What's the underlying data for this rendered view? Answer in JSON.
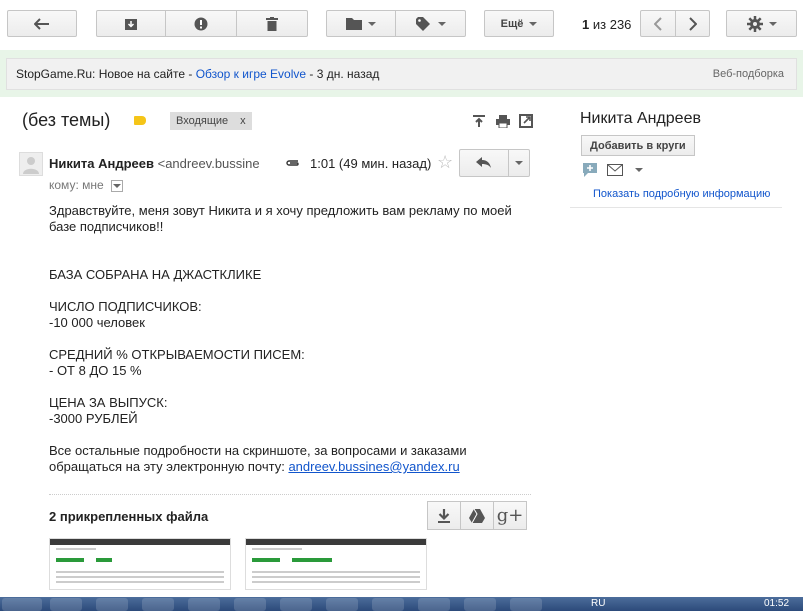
{
  "toolbar": {
    "more_label": "Ещё",
    "pager_current": "1",
    "pager_sep": "из",
    "pager_total": "236"
  },
  "promo": {
    "source": "StopGame.Ru: Новое на сайте",
    "dash1": " - ",
    "link": "Обзор к игре Evolve",
    "dash2": " - ",
    "age": "3 дн. назад",
    "right": "Веб-подборка"
  },
  "message": {
    "subject": "(без темы)",
    "label": "Входящие",
    "label_close": "x",
    "sender_name": "Никита Андреев",
    "sender_email": "<andreev.bussine",
    "time": "1:01 (49 мин. назад)",
    "to_line": "кому: мне",
    "body": [
      "Здравствуйте, меня зовут Никита и я хочу предложить вам рекламу по моей базе подписчиков!!",
      "",
      "",
      "БАЗА СОБРАНА НА ДЖАСТКЛИКЕ",
      "",
      "ЧИСЛО ПОДПИСЧИКОВ:",
      "-10 000 человек",
      "",
      "СРЕДНИЙ % ОТКРЫВАЕМОСТИ ПИСЕМ:",
      "- ОТ 8 ДО 15 %",
      "",
      "ЦЕНА ЗА ВЫПУСК:",
      "-3000 РУБЛЕЙ",
      "",
      "Все остальные подробности на скриншоте, за вопросами и заказами обращаться на эту электронную почту: "
    ],
    "contact_email": "andreev.bussines@yandex.ru",
    "attachments_title": "2 прикрепленных файла"
  },
  "sidebar": {
    "name": "Никита Андреев",
    "add_circles": "Добавить в круги",
    "details_link": "Показать подробную информацию"
  },
  "taskbar": {
    "lang": "RU",
    "clock": "01:52"
  }
}
